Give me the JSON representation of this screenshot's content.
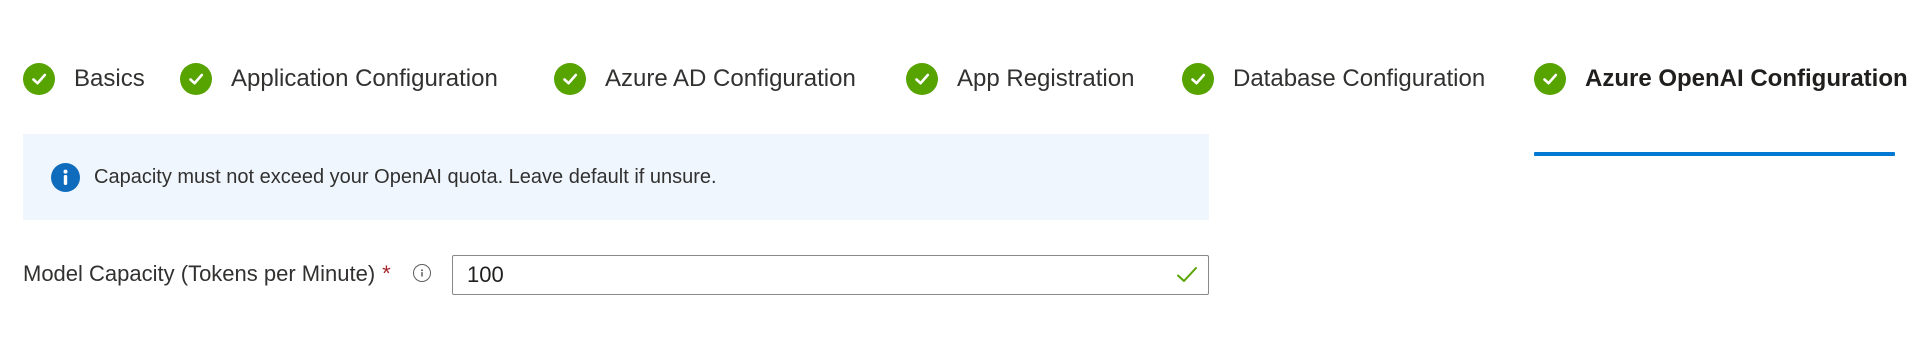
{
  "wizard": {
    "tabs": [
      {
        "label": "Basics",
        "status": "complete",
        "active": false
      },
      {
        "label": "Application Configuration",
        "status": "complete",
        "active": false
      },
      {
        "label": "Azure AD Configuration",
        "status": "complete",
        "active": false
      },
      {
        "label": "App Registration",
        "status": "complete",
        "active": false
      },
      {
        "label": "Database Configuration",
        "status": "complete",
        "active": false
      },
      {
        "label": "Azure OpenAI Configuration",
        "status": "complete",
        "active": true
      }
    ],
    "icons": {
      "complete": "checkmark-circle-icon"
    },
    "colors": {
      "complete": "#57a300",
      "active_underline": "#0078d4"
    }
  },
  "info_banner": {
    "icon": "info-icon",
    "text": "Capacity must not exceed your OpenAI quota. Leave default if unsure.",
    "colors": {
      "background": "#eff6fd",
      "icon": "#0f6cbd"
    }
  },
  "form": {
    "model_capacity": {
      "label": "Model Capacity (Tokens per Minute)",
      "required_marker": "*",
      "help_icon": "info-outline-icon",
      "value": "100",
      "validation_icon": "checkmark-icon",
      "valid": true,
      "colors": {
        "required": "#a4262c",
        "valid": "#57a300"
      }
    }
  }
}
